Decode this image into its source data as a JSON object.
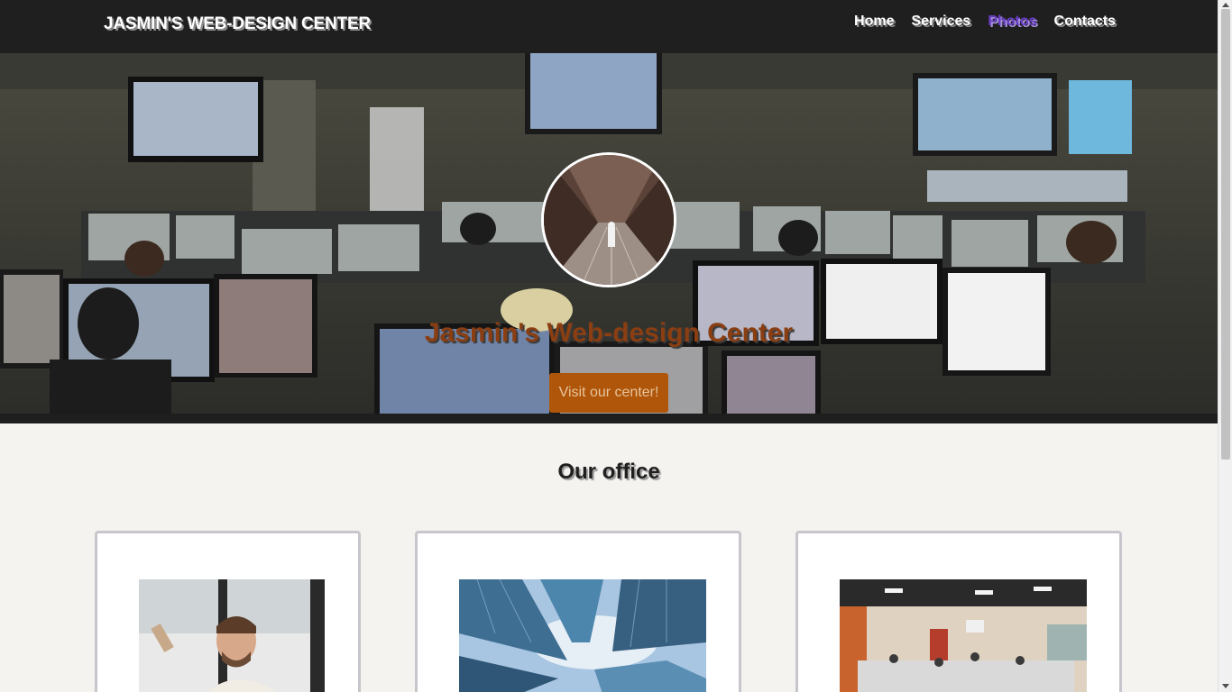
{
  "navbar": {
    "brand": "JASMIN'S WEB-DESIGN CENTER",
    "links": [
      {
        "label": "Home",
        "active": false
      },
      {
        "label": "Services",
        "active": false
      },
      {
        "label": "Photos",
        "active": true
      },
      {
        "label": "Contacts",
        "active": false
      }
    ]
  },
  "hero": {
    "title": "Jasmin's Web-design Center",
    "button_label": "Visit our center!"
  },
  "office": {
    "title": "Our office"
  },
  "colors": {
    "navbar_bg": "#1f1f1f",
    "accent_active_link": "#6a3ec9",
    "hero_title": "#8a3e12",
    "hero_button_bg": "#b0560a",
    "page_bg": "#f5f3ef"
  }
}
